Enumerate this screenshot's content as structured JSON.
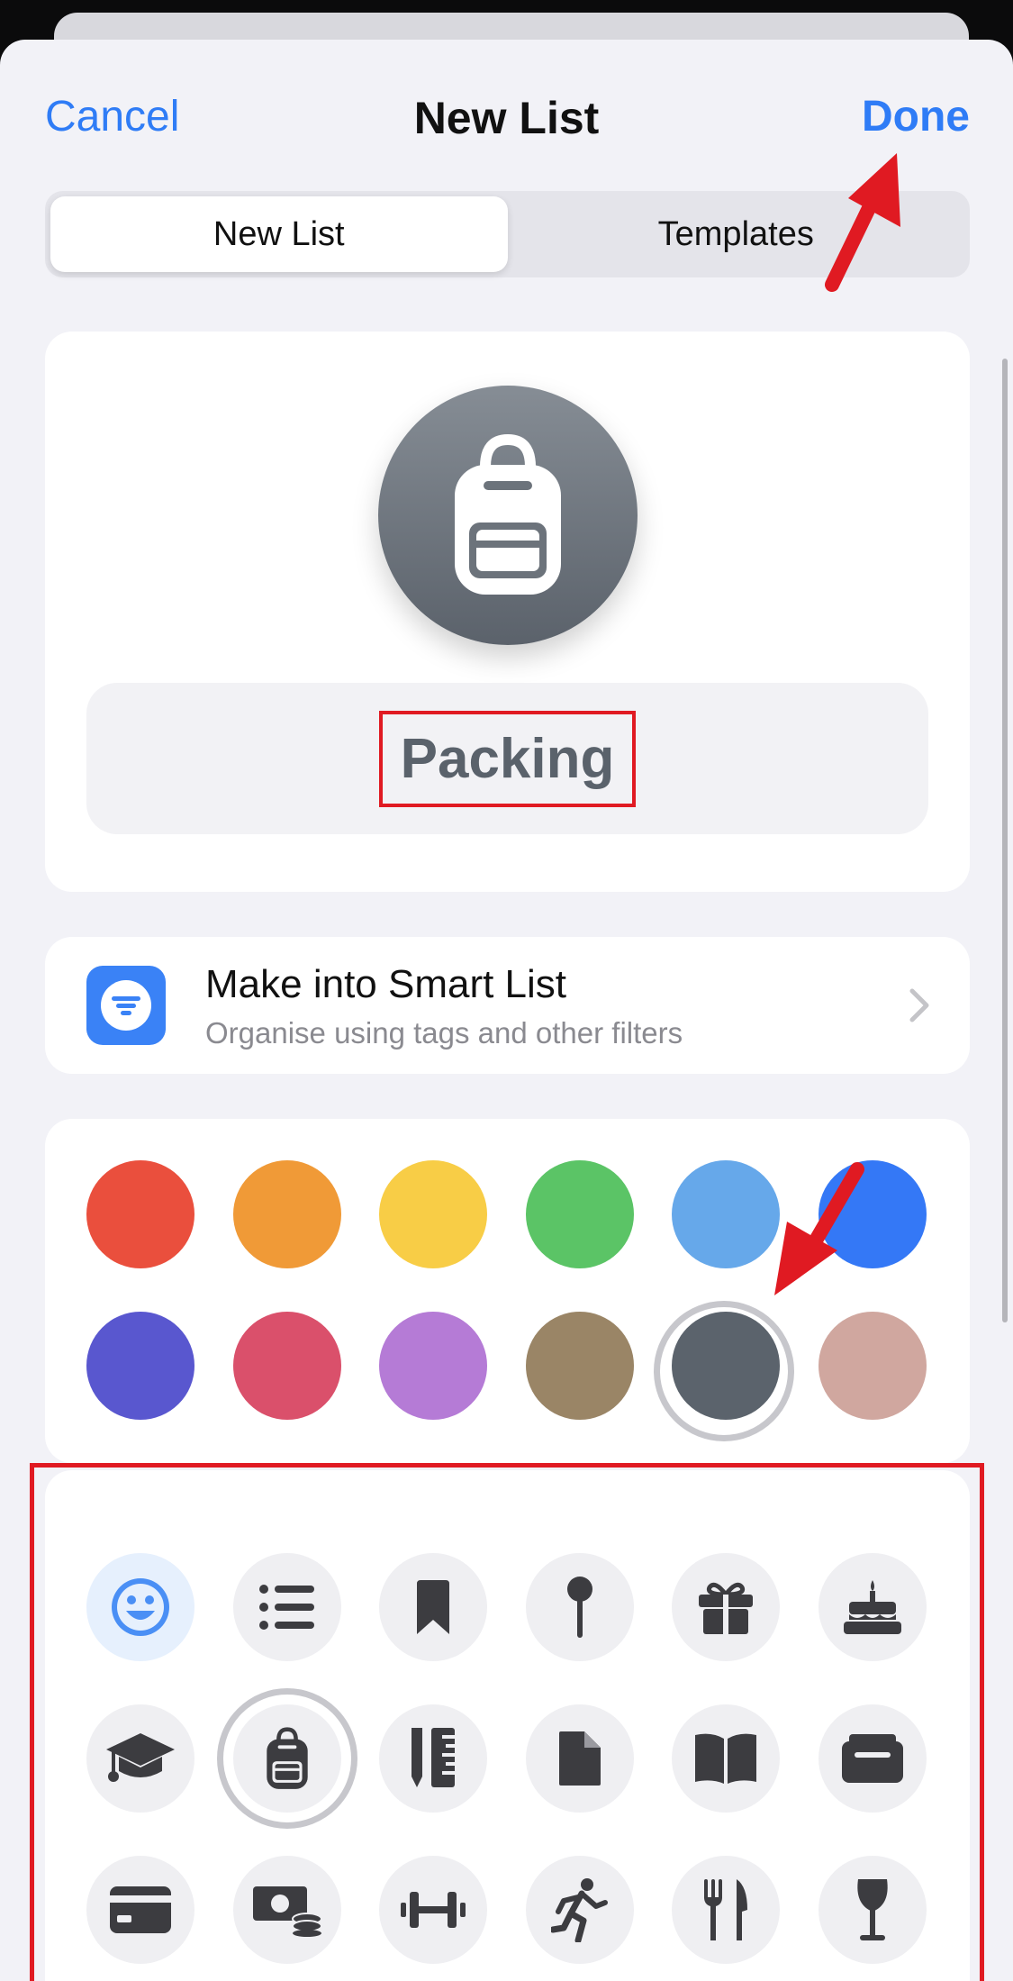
{
  "nav": {
    "cancel_label": "Cancel",
    "title": "New List",
    "done_label": "Done"
  },
  "segmented": {
    "new_list_label": "New List",
    "templates_label": "Templates",
    "selected": "New List"
  },
  "list": {
    "name": "Packing",
    "icon": "backpack-icon",
    "color": "#5b626b"
  },
  "smart_list": {
    "title": "Make into Smart List",
    "subtitle": "Organise using tags and other filters"
  },
  "colors": {
    "swatches": [
      "#ea4f3d",
      "#f09a37",
      "#f8cd46",
      "#5bc466",
      "#66a8ea",
      "#3478f6",
      "#5957cf",
      "#da506b",
      "#b57bd6",
      "#9a8566",
      "#5b636c",
      "#d0a79f"
    ],
    "selected_index": 10
  },
  "icons": {
    "items": [
      "smiley-icon",
      "list-icon",
      "bookmark-icon",
      "pin-icon",
      "gift-icon",
      "birthday-cake-icon",
      "graduation-cap-icon",
      "backpack-icon",
      "ruler-pencil-icon",
      "document-icon",
      "book-icon",
      "wallet-icon",
      "credit-card-icon",
      "money-icon",
      "dumbbell-icon",
      "runner-icon",
      "fork-knife-icon",
      "wine-glass-icon"
    ],
    "selected_index": 7
  },
  "accent_color": "#2f7cf6",
  "annotation_color": "#e01a22"
}
